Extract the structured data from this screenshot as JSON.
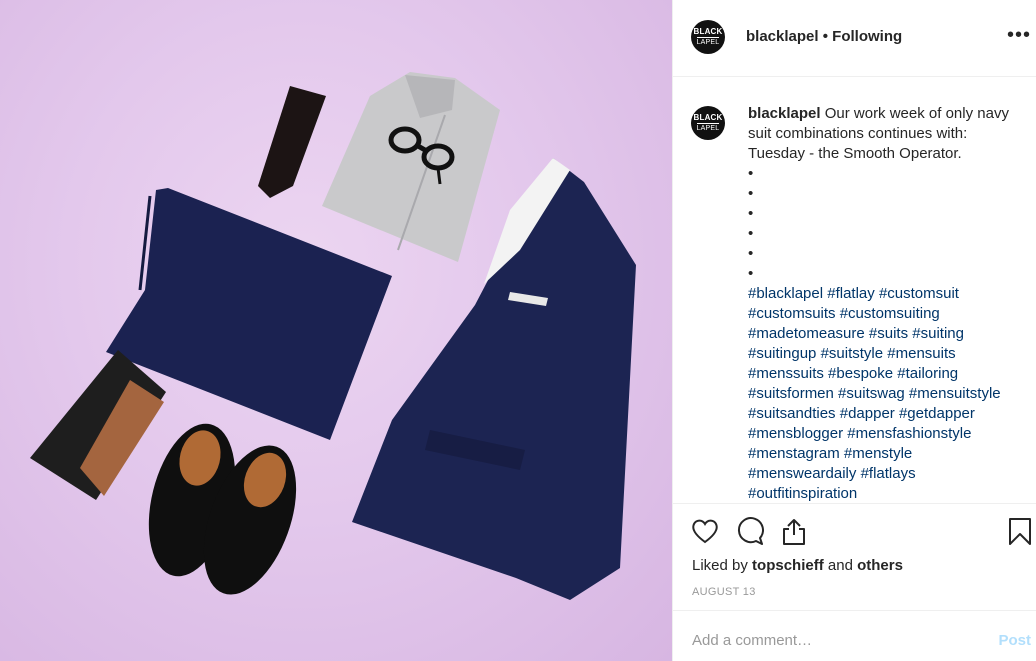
{
  "post": {
    "username": "blacklapel",
    "separator": "•",
    "follow_status": "Following",
    "more_label": "•••",
    "avatar_line1": "BLACK",
    "avatar_line2": "LAPEL",
    "caption_text": "Our work week of only navy suit combinations continues with: Tuesday - the Smooth Operator.",
    "bullets": [
      "•",
      "•",
      "•",
      "•",
      "•",
      "•"
    ],
    "hashtags": [
      "#blacklapel",
      "#flatlay",
      "#customsuit",
      "#customsuits",
      "#customsuiting",
      "#madetomeasure",
      "#suits",
      "#suiting",
      "#suitingup",
      "#suitstyle",
      "#mensuits",
      "#menssuits",
      "#bespoke",
      "#tailoring",
      "#suitsformen",
      "#suitswag",
      "#mensuitstyle",
      "#suitsandties",
      "#dapper",
      "#getdapper",
      "#mensblogger",
      "#mensfashionstyle",
      "#menstagram",
      "#menstyle",
      "#mensweardaily",
      "#flatlays",
      "#outfitinspiration"
    ],
    "liked_prefix": "Liked by",
    "liked_user": "topschieff",
    "liked_and": "and",
    "liked_others": "others",
    "date": "AUGUST 13",
    "comment_placeholder": "Add a comment…",
    "post_label": "Post"
  },
  "icons": {
    "like": "heart-icon",
    "comment": "comment-icon",
    "share": "share-icon",
    "save": "bookmark-icon"
  },
  "colors": {
    "hashtag": "#003569",
    "post_button": "#b2dffc",
    "photo_background": "#e3c8ec",
    "suit_navy": "#1c2452"
  }
}
